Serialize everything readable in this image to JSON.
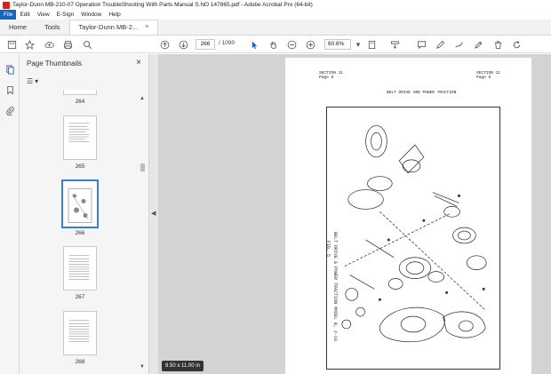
{
  "window": {
    "title": "Taylor-Dunn MB-210-07 Operation TroubleShooting With Parts Manual S.NO 147865.pdf - Adobe Acrobat Pro (64-bit)"
  },
  "menu": [
    "File",
    "Edit",
    "View",
    "E-Sign",
    "Window",
    "Help"
  ],
  "tabs": {
    "home": "Home",
    "tools": "Tools",
    "document": "Taylor-Dunn MB-2...",
    "close": "×"
  },
  "toolbar": {
    "page_current": "266",
    "page_total": "/ 1090",
    "zoom": "60.6%"
  },
  "thumbnails": {
    "title": "Page Thumbnails",
    "close": "×",
    "options_icon": "☰",
    "options_caret": "▾",
    "pages": [
      "264",
      "265",
      "266",
      "267",
      "268"
    ]
  },
  "document": {
    "section_left": "SECTION 11",
    "page_left": "Page 8",
    "section_right": "SECTION 11",
    "page_right": "Page 8",
    "heading": "BELT DRIVE AND POWER TRACTION",
    "vertical_caption": "BELT DRIVE & POWER TRACTION MODEL B, 2-10",
    "fig": "FIG. 5",
    "page_size": "8.50 x 11.00 in"
  },
  "colors": {
    "accent": "#1565c0",
    "selection": "#3b7bd8",
    "acrobat_red": "#d8201f"
  }
}
